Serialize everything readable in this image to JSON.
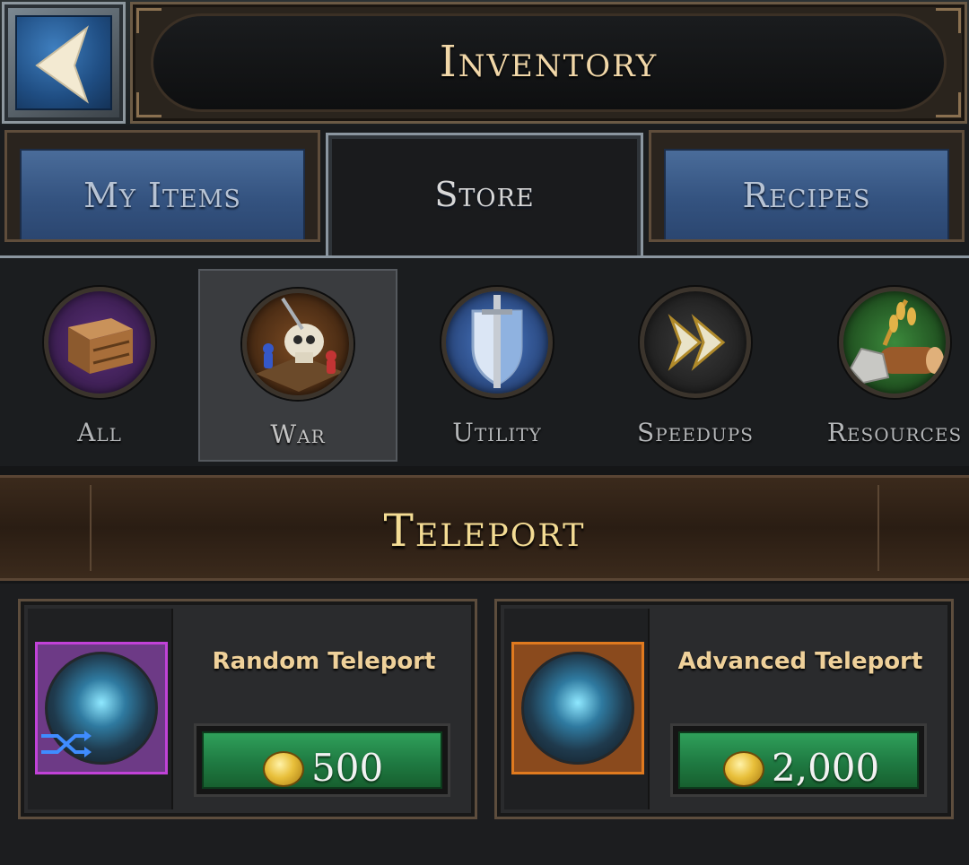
{
  "header": {
    "title": "Inventory"
  },
  "tabs": [
    {
      "label": "My Items",
      "active": false
    },
    {
      "label": "Store",
      "active": true
    },
    {
      "label": "Recipes",
      "active": false
    }
  ],
  "categories": [
    {
      "label": "All",
      "icon": "crate-icon",
      "selected": false
    },
    {
      "label": "War",
      "icon": "skull-war-icon",
      "selected": true
    },
    {
      "label": "Utility",
      "icon": "sword-shield-icon",
      "selected": false
    },
    {
      "label": "Speedups",
      "icon": "fast-forward-icon",
      "selected": false
    },
    {
      "label": "Resources",
      "icon": "resources-icon",
      "selected": false
    }
  ],
  "section": {
    "title": "Teleport"
  },
  "items": [
    {
      "name": "Random Teleport",
      "price": "500",
      "currency": "gold-coin-icon",
      "rarity_color": "#c142d8"
    },
    {
      "name": "Advanced Teleport",
      "price": "2,000",
      "currency": "gold-coin-icon",
      "rarity_color": "#e07a1f"
    }
  ],
  "colors": {
    "accent_gold": "#f4dc94",
    "tab_blue": "#345380",
    "buy_green": "#1f7a42"
  }
}
